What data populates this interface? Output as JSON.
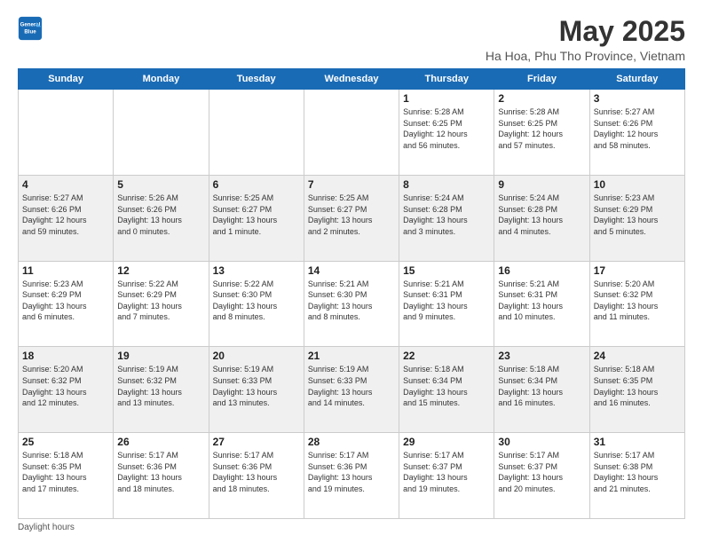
{
  "header": {
    "logo_line1": "General",
    "logo_line2": "Blue",
    "title": "May 2025",
    "subtitle": "Ha Hoa, Phu Tho Province, Vietnam"
  },
  "days_of_week": [
    "Sunday",
    "Monday",
    "Tuesday",
    "Wednesday",
    "Thursday",
    "Friday",
    "Saturday"
  ],
  "weeks": [
    [
      {
        "day": "",
        "info": ""
      },
      {
        "day": "",
        "info": ""
      },
      {
        "day": "",
        "info": ""
      },
      {
        "day": "",
        "info": ""
      },
      {
        "day": "1",
        "info": "Sunrise: 5:28 AM\nSunset: 6:25 PM\nDaylight: 12 hours\nand 56 minutes."
      },
      {
        "day": "2",
        "info": "Sunrise: 5:28 AM\nSunset: 6:25 PM\nDaylight: 12 hours\nand 57 minutes."
      },
      {
        "day": "3",
        "info": "Sunrise: 5:27 AM\nSunset: 6:26 PM\nDaylight: 12 hours\nand 58 minutes."
      }
    ],
    [
      {
        "day": "4",
        "info": "Sunrise: 5:27 AM\nSunset: 6:26 PM\nDaylight: 12 hours\nand 59 minutes."
      },
      {
        "day": "5",
        "info": "Sunrise: 5:26 AM\nSunset: 6:26 PM\nDaylight: 13 hours\nand 0 minutes."
      },
      {
        "day": "6",
        "info": "Sunrise: 5:25 AM\nSunset: 6:27 PM\nDaylight: 13 hours\nand 1 minute."
      },
      {
        "day": "7",
        "info": "Sunrise: 5:25 AM\nSunset: 6:27 PM\nDaylight: 13 hours\nand 2 minutes."
      },
      {
        "day": "8",
        "info": "Sunrise: 5:24 AM\nSunset: 6:28 PM\nDaylight: 13 hours\nand 3 minutes."
      },
      {
        "day": "9",
        "info": "Sunrise: 5:24 AM\nSunset: 6:28 PM\nDaylight: 13 hours\nand 4 minutes."
      },
      {
        "day": "10",
        "info": "Sunrise: 5:23 AM\nSunset: 6:29 PM\nDaylight: 13 hours\nand 5 minutes."
      }
    ],
    [
      {
        "day": "11",
        "info": "Sunrise: 5:23 AM\nSunset: 6:29 PM\nDaylight: 13 hours\nand 6 minutes."
      },
      {
        "day": "12",
        "info": "Sunrise: 5:22 AM\nSunset: 6:29 PM\nDaylight: 13 hours\nand 7 minutes."
      },
      {
        "day": "13",
        "info": "Sunrise: 5:22 AM\nSunset: 6:30 PM\nDaylight: 13 hours\nand 8 minutes."
      },
      {
        "day": "14",
        "info": "Sunrise: 5:21 AM\nSunset: 6:30 PM\nDaylight: 13 hours\nand 8 minutes."
      },
      {
        "day": "15",
        "info": "Sunrise: 5:21 AM\nSunset: 6:31 PM\nDaylight: 13 hours\nand 9 minutes."
      },
      {
        "day": "16",
        "info": "Sunrise: 5:21 AM\nSunset: 6:31 PM\nDaylight: 13 hours\nand 10 minutes."
      },
      {
        "day": "17",
        "info": "Sunrise: 5:20 AM\nSunset: 6:32 PM\nDaylight: 13 hours\nand 11 minutes."
      }
    ],
    [
      {
        "day": "18",
        "info": "Sunrise: 5:20 AM\nSunset: 6:32 PM\nDaylight: 13 hours\nand 12 minutes."
      },
      {
        "day": "19",
        "info": "Sunrise: 5:19 AM\nSunset: 6:32 PM\nDaylight: 13 hours\nand 13 minutes."
      },
      {
        "day": "20",
        "info": "Sunrise: 5:19 AM\nSunset: 6:33 PM\nDaylight: 13 hours\nand 13 minutes."
      },
      {
        "day": "21",
        "info": "Sunrise: 5:19 AM\nSunset: 6:33 PM\nDaylight: 13 hours\nand 14 minutes."
      },
      {
        "day": "22",
        "info": "Sunrise: 5:18 AM\nSunset: 6:34 PM\nDaylight: 13 hours\nand 15 minutes."
      },
      {
        "day": "23",
        "info": "Sunrise: 5:18 AM\nSunset: 6:34 PM\nDaylight: 13 hours\nand 16 minutes."
      },
      {
        "day": "24",
        "info": "Sunrise: 5:18 AM\nSunset: 6:35 PM\nDaylight: 13 hours\nand 16 minutes."
      }
    ],
    [
      {
        "day": "25",
        "info": "Sunrise: 5:18 AM\nSunset: 6:35 PM\nDaylight: 13 hours\nand 17 minutes."
      },
      {
        "day": "26",
        "info": "Sunrise: 5:17 AM\nSunset: 6:36 PM\nDaylight: 13 hours\nand 18 minutes."
      },
      {
        "day": "27",
        "info": "Sunrise: 5:17 AM\nSunset: 6:36 PM\nDaylight: 13 hours\nand 18 minutes."
      },
      {
        "day": "28",
        "info": "Sunrise: 5:17 AM\nSunset: 6:36 PM\nDaylight: 13 hours\nand 19 minutes."
      },
      {
        "day": "29",
        "info": "Sunrise: 5:17 AM\nSunset: 6:37 PM\nDaylight: 13 hours\nand 19 minutes."
      },
      {
        "day": "30",
        "info": "Sunrise: 5:17 AM\nSunset: 6:37 PM\nDaylight: 13 hours\nand 20 minutes."
      },
      {
        "day": "31",
        "info": "Sunrise: 5:17 AM\nSunset: 6:38 PM\nDaylight: 13 hours\nand 21 minutes."
      }
    ]
  ],
  "footer": {
    "note": "Daylight hours"
  }
}
